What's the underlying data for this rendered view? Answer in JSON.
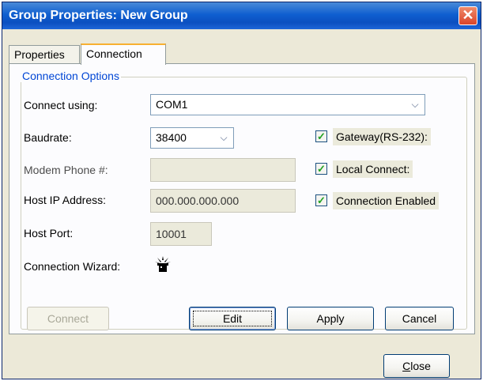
{
  "window": {
    "title": "Group Properties: New Group",
    "close_glyph": "✕"
  },
  "tabs": [
    {
      "label": "Properties",
      "active": false
    },
    {
      "label": "Connection",
      "active": true
    }
  ],
  "connection_options": {
    "legend": "Connection Options",
    "connect_using": {
      "label": "Connect using:",
      "value": "COM1"
    },
    "baudrate": {
      "label": "Baudrate:",
      "value": "38400"
    },
    "modem_phone": {
      "label": "Modem Phone #:",
      "value": ""
    },
    "host_ip": {
      "label": "Host IP Address:",
      "value": "000.000.000.000"
    },
    "host_port": {
      "label": "Host Port:",
      "value": "10001"
    },
    "connection_wizard": {
      "label": "Connection Wizard:",
      "icon": "wizard-icon"
    },
    "checks": [
      {
        "label": "Gateway(RS-232):",
        "checked": true
      },
      {
        "label": "Local Connect:",
        "checked": true
      },
      {
        "label": "Connection Enabled",
        "checked": true
      }
    ]
  },
  "buttons": {
    "connect": "Connect",
    "edit": "Edit",
    "apply": "Apply",
    "cancel": "Cancel",
    "close_prefix": "C",
    "close_rest": "lose"
  },
  "colors": {
    "title_bar": "#0b4fc0",
    "group_legend": "#0046d5",
    "checkmark": "#21a121"
  }
}
